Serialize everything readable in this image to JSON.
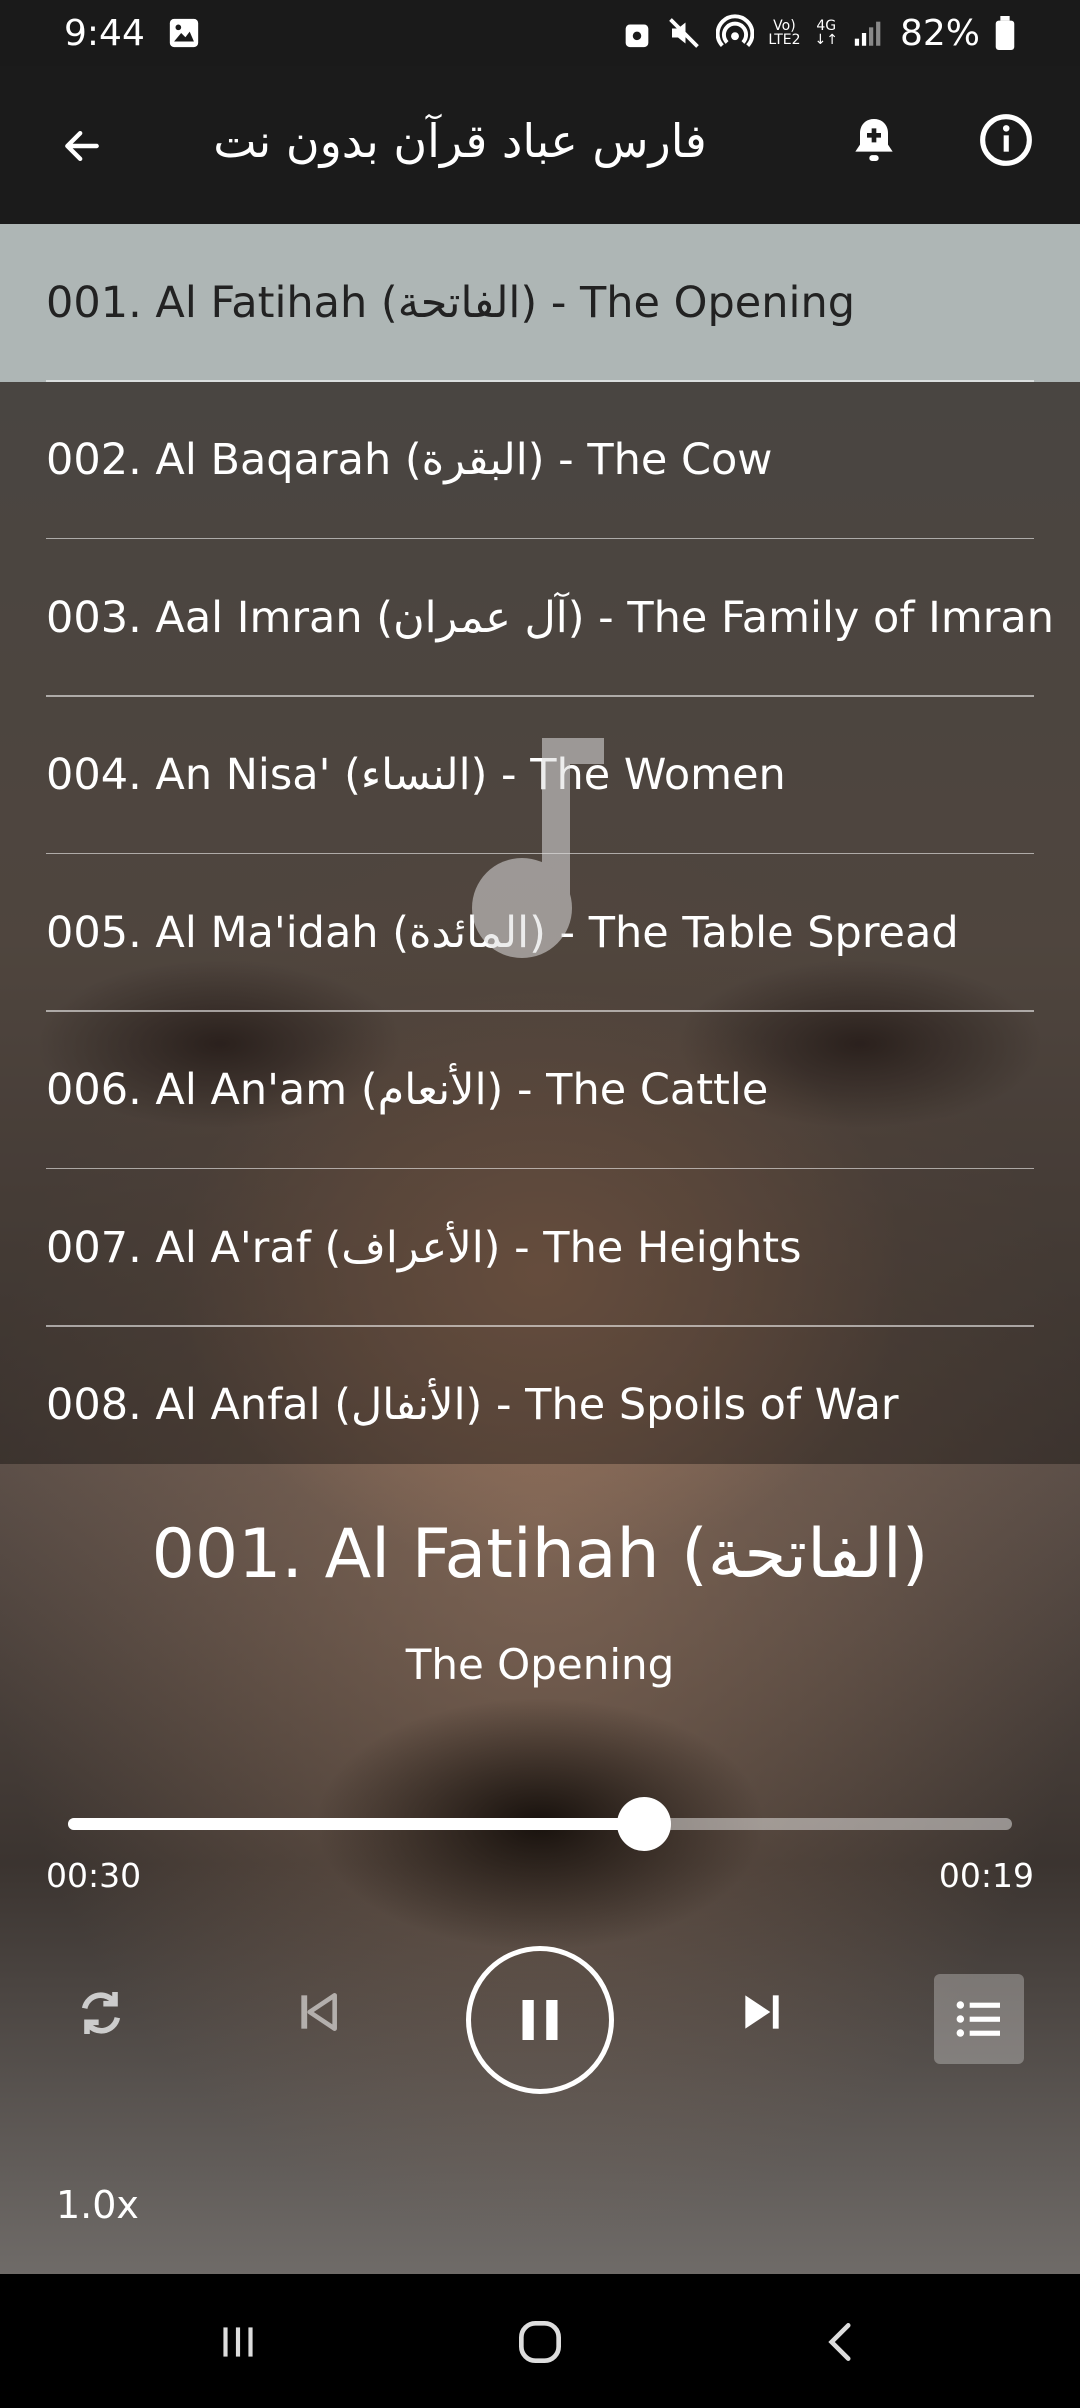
{
  "status": {
    "time": "9:44",
    "network_top": "Vo)",
    "network_bottom": "LTE2",
    "net_4g": "4G",
    "battery": "82%"
  },
  "appbar": {
    "title": "فارس عباد قرآن بدون نت"
  },
  "tracks": [
    {
      "label": "001. Al Fatihah (الفاتحة) - The Opening",
      "active": true
    },
    {
      "label": "002. Al Baqarah (البقرة) - The Cow"
    },
    {
      "label": "003. Aal Imran (آل عمران) - The Family of Imran"
    },
    {
      "label": "004. An Nisa' (النساء) - The Women"
    },
    {
      "label": "005. Al Ma'idah (المائدة) - The Table Spread"
    },
    {
      "label": "006. Al An'am (الأنعام) - The Cattle"
    },
    {
      "label": "007. Al A'raf (الأعراف) - The Heights"
    },
    {
      "label": "008. Al Anfal (الأنفال) - The Spoils of War"
    }
  ],
  "player": {
    "now_title": "001. Al Fatihah (الفاتحة)",
    "now_subtitle": "The Opening",
    "progress": 0.61,
    "elapsed": "00:30",
    "remaining": "00:19",
    "speed": "1.0x"
  },
  "icons": {
    "back": "arrow-left-icon",
    "bell": "bell-plus-icon",
    "info": "info-icon",
    "repeat": "repeat-icon",
    "prev": "skip-previous-icon",
    "pause": "pause-icon",
    "next": "skip-next-icon",
    "playlist": "list-icon"
  }
}
